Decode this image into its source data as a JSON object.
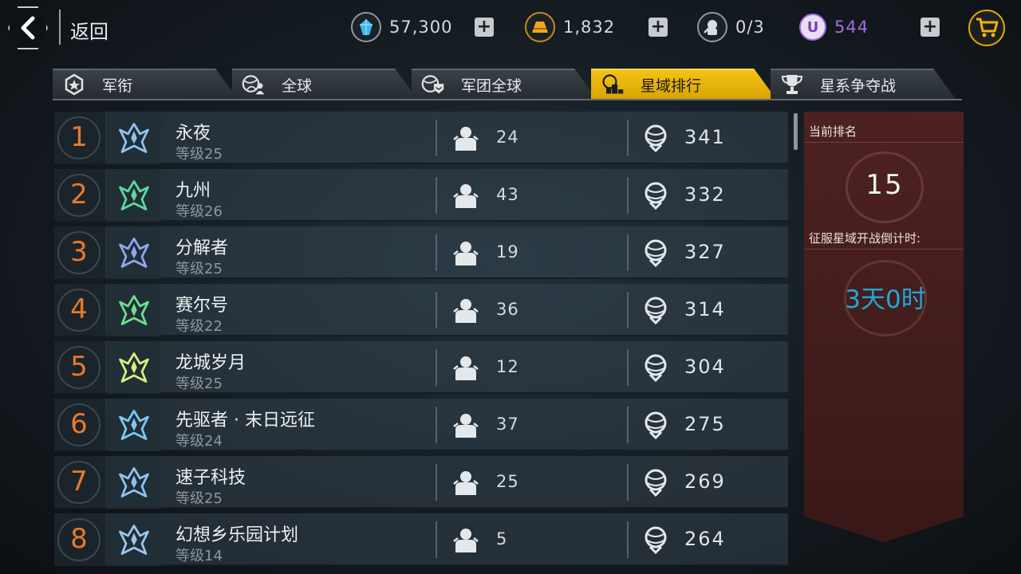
{
  "header": {
    "back_label": "返回",
    "resources": [
      {
        "icon": "crystal-icon",
        "value": "57,300"
      },
      {
        "icon": "gold-bar-icon",
        "value": "1,832"
      },
      {
        "icon": "robot-energy-icon",
        "value": "0/3"
      },
      {
        "icon": "u-coin-icon",
        "value": "544"
      }
    ]
  },
  "tabs": [
    {
      "label": "军衔",
      "icon": "rank-badge-icon",
      "active": false
    },
    {
      "label": "全球",
      "icon": "globe-player-icon",
      "active": false
    },
    {
      "label": "军团全球",
      "icon": "globe-legion-icon",
      "active": false
    },
    {
      "label": "星域排行",
      "icon": "podium-icon",
      "active": true
    },
    {
      "label": "星系争夺战",
      "icon": "trophy-icon",
      "active": false
    }
  ],
  "rankings": [
    {
      "rank": "1",
      "name": "永夜",
      "level": "等级25",
      "members": "24",
      "score": "341",
      "emblem_color": "#8fc3f0"
    },
    {
      "rank": "2",
      "name": "九州",
      "level": "等级26",
      "members": "43",
      "score": "332",
      "emblem_color": "#5fd8a0"
    },
    {
      "rank": "3",
      "name": "分解者",
      "level": "等级25",
      "members": "19",
      "score": "327",
      "emblem_color": "#8fa8f0"
    },
    {
      "rank": "4",
      "name": "赛尔号",
      "level": "等级22",
      "members": "36",
      "score": "314",
      "emblem_color": "#6ee08a"
    },
    {
      "rank": "5",
      "name": "龙城岁月",
      "level": "等级25",
      "members": "12",
      "score": "304",
      "emblem_color": "#d8ef7a"
    },
    {
      "rank": "6",
      "name": "先驱者 · 末日远征",
      "level": "等级24",
      "members": "37",
      "score": "275",
      "emblem_color": "#7fc8f2"
    },
    {
      "rank": "7",
      "name": "速子科技",
      "level": "等级25",
      "members": "25",
      "score": "269",
      "emblem_color": "#8fc3f0"
    },
    {
      "rank": "8",
      "name": "幻想乡乐园计划",
      "level": "等级14",
      "members": "5",
      "score": "264",
      "emblem_color": "#9ac8f0"
    }
  ],
  "panel": {
    "current_rank_label": "当前排名",
    "current_rank": "15",
    "countdown_label": "征服星域开战倒计时:",
    "countdown": "3天0时"
  },
  "colors": {
    "accent": "#f4c218",
    "rank_number": "#e8792a",
    "countdown": "#1fa8d6",
    "u_coin": "#a56be0"
  }
}
